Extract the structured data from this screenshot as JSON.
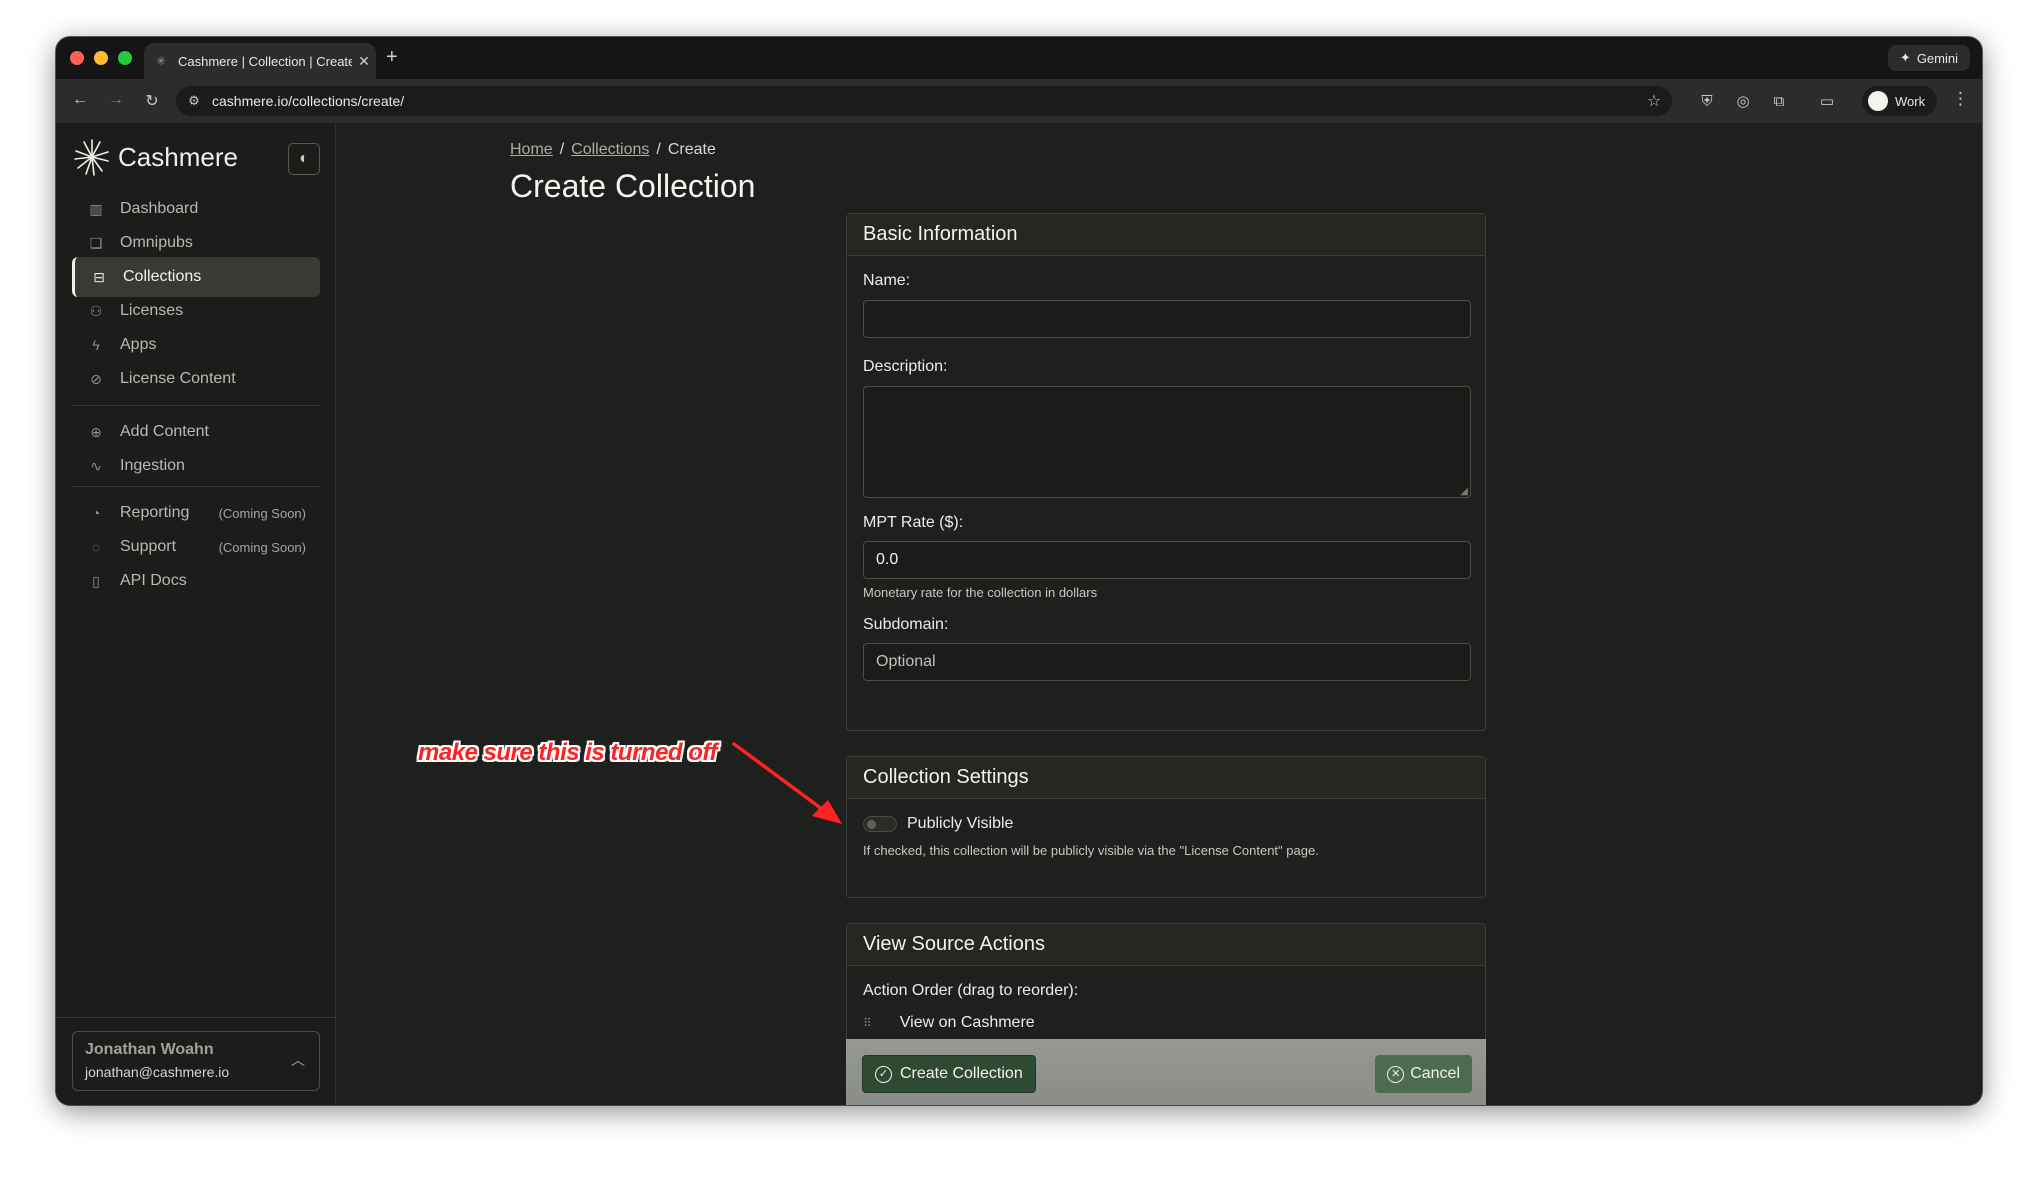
{
  "browser": {
    "tab_title": "Cashmere | Collection | Create",
    "new_tab_symbol": "+",
    "gemini_label": "Gemini",
    "url": "cashmere.io/collections/create/",
    "profile_label": "Work"
  },
  "sidebar": {
    "brand": "Cashmere",
    "items": [
      {
        "label": "Dashboard"
      },
      {
        "label": "Omnipubs"
      },
      {
        "label": "Collections"
      },
      {
        "label": "Licenses"
      },
      {
        "label": "Apps"
      },
      {
        "label": "License Content"
      },
      {
        "label": "Add Content"
      },
      {
        "label": "Ingestion"
      },
      {
        "label": "Reporting",
        "badge": "(Coming Soon)"
      },
      {
        "label": "Support",
        "badge": "(Coming Soon)"
      },
      {
        "label": "API Docs"
      }
    ],
    "user": {
      "name": "Jonathan Woahn",
      "email": "jonathan@cashmere.io"
    }
  },
  "breadcrumb": {
    "home": "Home",
    "collections": "Collections",
    "current": "Create",
    "separator": "/"
  },
  "page_title": "Create Collection",
  "basic_info": {
    "header": "Basic Information",
    "name_label": "Name:",
    "description_label": "Description:",
    "mpt_label": "MPT Rate ($):",
    "mpt_value": "0.0",
    "mpt_help": "Monetary rate for the collection in dollars",
    "subdomain_label": "Subdomain:",
    "subdomain_placeholder": "Optional"
  },
  "collection_settings": {
    "header": "Collection Settings",
    "toggle_label": "Publicly Visible",
    "toggle_on": false,
    "toggle_help": "If checked, this collection will be publicly visible via the \"License Content\" page."
  },
  "view_source": {
    "header": "View Source Actions",
    "order_label": "Action Order (drag to reorder):",
    "first_action": "View on Cashmere"
  },
  "actions": {
    "create_label": "Create Collection",
    "cancel_label": "Cancel"
  },
  "annotation": {
    "text": "make sure this is turned off",
    "color": "#ff2222"
  }
}
